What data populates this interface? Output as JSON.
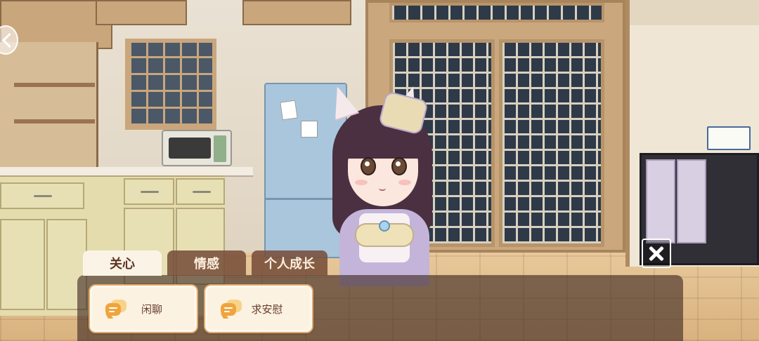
{
  "tabs": [
    {
      "label": "关心",
      "active": true
    },
    {
      "label": "情感",
      "active": false
    },
    {
      "label": "个人成长",
      "active": false
    }
  ],
  "actions": [
    {
      "label": "闲聊",
      "icon": "chat-bubble-icon"
    },
    {
      "label": "求安慰",
      "icon": "chat-bubble-icon"
    }
  ],
  "controls": {
    "close_icon": "close-icon",
    "nav_left_icon": "chevron-left-icon"
  },
  "colors": {
    "active_tab_bg": "#fbf4e6",
    "inactive_tab_bg": "#784e3a",
    "button_border": "#e0a96b",
    "icon_orange": "#f0a43c",
    "panel_bg": "#3e2822"
  }
}
